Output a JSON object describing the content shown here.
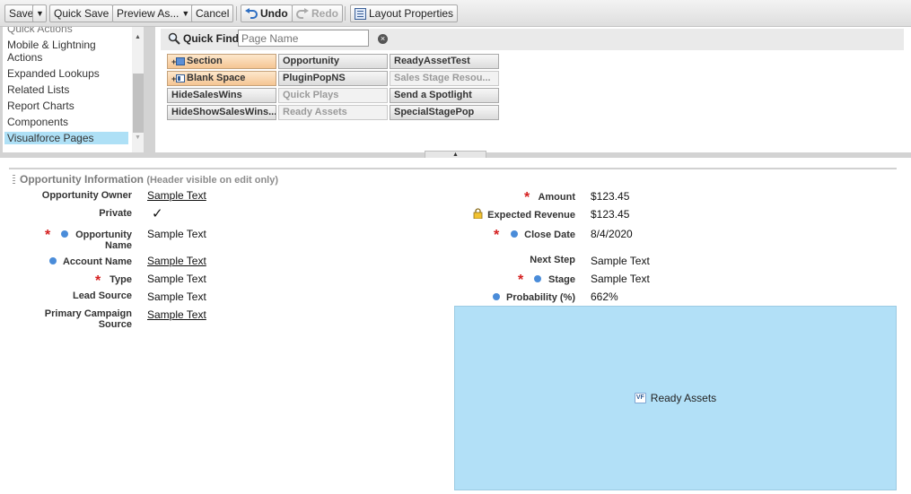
{
  "toolbar": {
    "save": "Save",
    "quick_save": "Quick Save",
    "preview_as": "Preview As...",
    "cancel": "Cancel",
    "undo": "Undo",
    "redo": "Redo",
    "layout_properties": "Layout Properties"
  },
  "left_list": {
    "items": [
      "Quick Actions",
      "Mobile & Lightning Actions",
      "Expanded Lookups",
      "Related Lists",
      "Report Charts",
      "Components",
      "Visualforce Pages"
    ],
    "selected": "Visualforce Pages"
  },
  "quick_find": {
    "label": "Quick Find",
    "placeholder": "Page Name"
  },
  "palette": {
    "items": [
      {
        "label": "Section",
        "state": "special",
        "icon": "section-icon"
      },
      {
        "label": "Opportunity",
        "state": "available"
      },
      {
        "label": "ReadyAssetTest",
        "state": "available"
      },
      {
        "label": "Blank Space",
        "state": "special",
        "icon": "blank-space-icon"
      },
      {
        "label": "PluginPopNS",
        "state": "available"
      },
      {
        "label": "Sales Stage Resou...",
        "state": "used"
      },
      {
        "label": "HideSalesWins",
        "state": "available"
      },
      {
        "label": "Quick Plays",
        "state": "used"
      },
      {
        "label": "Send a Spotlight",
        "state": "available"
      },
      {
        "label": "HideShowSalesWins...",
        "state": "available"
      },
      {
        "label": "Ready Assets",
        "state": "used"
      },
      {
        "label": "SpecialStagePop",
        "state": "available"
      }
    ]
  },
  "section": {
    "title": "Opportunity Information",
    "subtitle": "(Header visible on edit only)"
  },
  "left_fields": [
    {
      "label": "Opportunity Owner",
      "value": "Sample Text",
      "link": true
    },
    {
      "label": "Private",
      "value": "✓"
    },
    {
      "label": "Opportunity Name",
      "value": "Sample Text",
      "required": true,
      "dot": true
    },
    {
      "label": "Account Name",
      "value": "Sample Text",
      "link": true,
      "dot": true
    },
    {
      "label": "Type",
      "value": "Sample Text",
      "required": true
    },
    {
      "label": "Lead Source",
      "value": "Sample Text"
    },
    {
      "label": "Primary Campaign Source",
      "value": "Sample Text",
      "link": true
    }
  ],
  "right_fields": [
    {
      "label": "Amount",
      "value": "$123.45",
      "required": true
    },
    {
      "label": "Expected Revenue",
      "value": "$123.45",
      "locked": true
    },
    {
      "label": "Close Date",
      "value": "8/4/2020",
      "required": true,
      "dot": true
    },
    {
      "label": "Next Step",
      "value": "Sample Text"
    },
    {
      "label": "Stage",
      "value": "Sample Text",
      "required": true,
      "dot": true
    },
    {
      "label": "Probability (%)",
      "value": "662%",
      "dot": true
    }
  ],
  "vf_component": {
    "label": "Ready Assets",
    "icon_text": "VF"
  },
  "colors": {
    "required": "#d51f1f",
    "dot": "#4a8cd9",
    "vf_box": "#b2e0f7",
    "selected_list_item": "#aee0f6"
  }
}
